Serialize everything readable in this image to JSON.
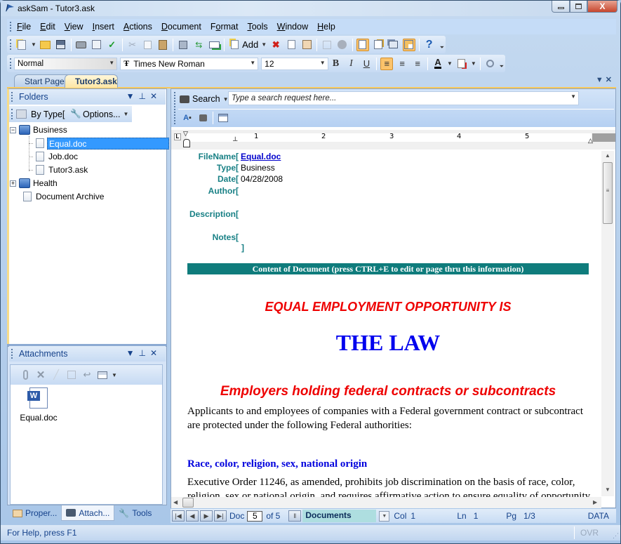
{
  "window": {
    "title": "askSam - Tutor3.ask",
    "buttons": {
      "minimize": "—",
      "maximize": "▢",
      "close": "X"
    }
  },
  "menubar": {
    "items": [
      {
        "label": "File",
        "mnemonic": "F"
      },
      {
        "label": "Edit",
        "mnemonic": "E"
      },
      {
        "label": "View",
        "mnemonic": "V"
      },
      {
        "label": "Insert",
        "mnemonic": "I"
      },
      {
        "label": "Actions",
        "mnemonic": "A"
      },
      {
        "label": "Document",
        "mnemonic": "D"
      },
      {
        "label": "Format",
        "mnemonic": "o"
      },
      {
        "label": "Tools",
        "mnemonic": "T"
      },
      {
        "label": "Window",
        "mnemonic": "W"
      },
      {
        "label": "Help",
        "mnemonic": "H"
      }
    ]
  },
  "toolbar": {
    "add_label": "Add",
    "help_glyph": "?"
  },
  "format_toolbar": {
    "style": "Normal",
    "font": "Times New Roman",
    "size": "12",
    "bold": "B",
    "italic": "I",
    "underline": "U",
    "font_color_glyph": "A"
  },
  "tabs": [
    {
      "label": "Start Page",
      "active": false
    },
    {
      "label": "Tutor3.ask",
      "active": true
    }
  ],
  "folders_pane": {
    "title": "Folders",
    "by_type_label": "By Type[",
    "options_label": "Options...",
    "tree": [
      {
        "label": "Business",
        "type": "folder",
        "expanded": true,
        "level": 0
      },
      {
        "label": "Equal.doc",
        "type": "doc",
        "level": 1,
        "selected": true
      },
      {
        "label": "Job.doc",
        "type": "doc",
        "level": 1
      },
      {
        "label": "Tutor3.ask",
        "type": "doc",
        "level": 1
      },
      {
        "label": "Health",
        "type": "folder",
        "expanded": false,
        "level": 0
      },
      {
        "label": "Document Archive",
        "type": "doc",
        "level": 0
      }
    ]
  },
  "attachments_pane": {
    "title": "Attachments",
    "files": [
      {
        "name": "Equal.doc"
      }
    ]
  },
  "bottom_tabs": [
    {
      "label": "Proper..."
    },
    {
      "label": "Attach...",
      "active": true
    },
    {
      "label": "Tools"
    }
  ],
  "search": {
    "label": "Search",
    "placeholder": "Type a search request here..."
  },
  "ruler": {
    "numbers": [
      "1",
      "2",
      "3",
      "4",
      "5"
    ]
  },
  "document": {
    "fields": [
      {
        "label": "FileName[",
        "value": "Equal.doc",
        "link": true
      },
      {
        "label": "Type[",
        "value": "Business"
      },
      {
        "label": "Date[",
        "value": "04/28/2008"
      },
      {
        "label": "Author[",
        "value": ""
      },
      {
        "label": "Description[",
        "value": ""
      },
      {
        "label": "Notes[",
        "value": ""
      }
    ],
    "notes_close": "]",
    "banner": "Content of Document (press CTRL+E to edit or page thru this information)",
    "heading1": "EQUAL EMPLOYMENT OPPORTUNITY IS",
    "heading2": "THE LAW",
    "heading3": "Employers holding federal contracts or subcontracts",
    "para1": "Applicants to and employees of companies with a Federal government contract or subcontract are protected under the following Federal authorities:",
    "subheading": "Race, color, religion, sex, national origin",
    "para2_line1": "Executive Order 11246, as amended, prohibits job discrimination on the basis of race, color,",
    "para2_line2": "religion, sex or national origin, and requires affirmative action to ensure equality of opportunity in"
  },
  "navbar": {
    "doc_label": "Doc",
    "doc_value": "5",
    "of_label": "of 5",
    "view": "Documents",
    "col_label": "Col",
    "col_value": "1",
    "ln_label": "Ln",
    "ln_value": "1",
    "pg_label": "Pg",
    "pg_value": "1/3",
    "mode": "DATA"
  },
  "statusbar": {
    "help": "For Help, press F1",
    "ovr": "OVR"
  },
  "colors": {
    "field_label": "#188085",
    "banner": "#0f7c7c",
    "red_heading": "#ee0000",
    "blue_heading": "#0000ee",
    "selection": "#3399ff"
  }
}
